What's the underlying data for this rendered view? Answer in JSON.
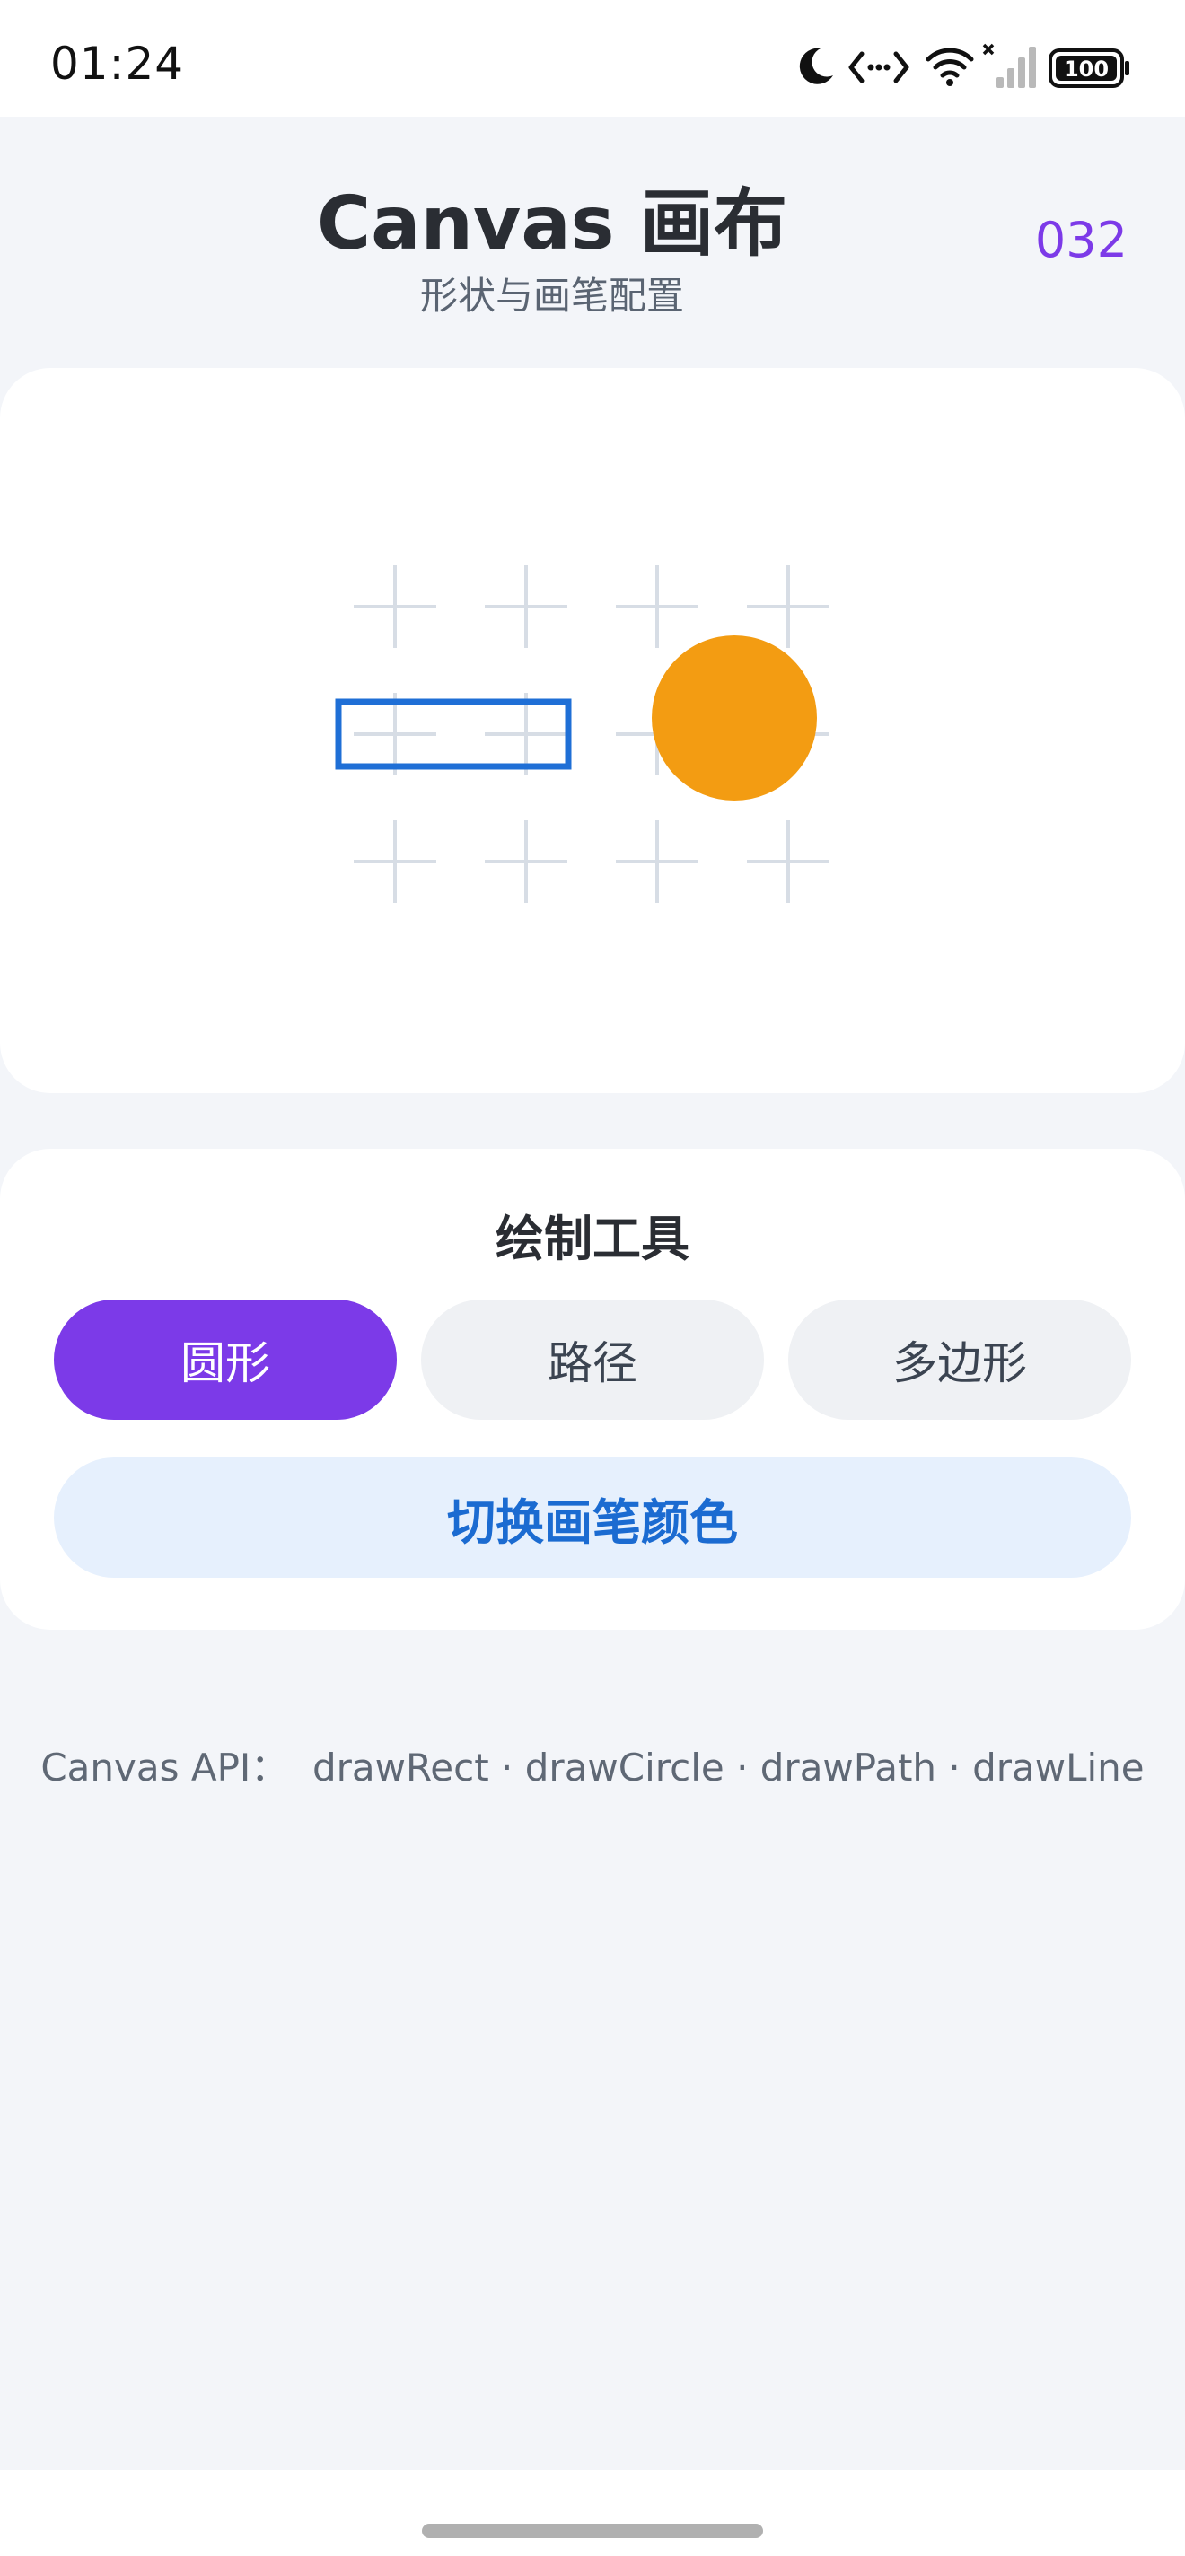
{
  "status_bar": {
    "time": "01:24",
    "icons": [
      "moon-icon",
      "network-arrows-icon",
      "wifi-icon",
      "signal-icon",
      "battery-icon"
    ],
    "battery_level": "100"
  },
  "header": {
    "title": "Canvas 画布",
    "subtitle": "形状与画笔配置",
    "counter": "032"
  },
  "canvas": {
    "shapes": [
      {
        "type": "rectangle",
        "style": "outline",
        "color": "#1f6fd6"
      },
      {
        "type": "circle",
        "style": "filled",
        "color": "#f39c12"
      }
    ],
    "grid_marker_color": "#d7dde5"
  },
  "tools": {
    "title": "绘制工具",
    "buttons": [
      {
        "label": "圆形",
        "selected": true
      },
      {
        "label": "路径",
        "selected": false
      },
      {
        "label": "多边形",
        "selected": false
      }
    ],
    "color_button": "切换画笔颜色"
  },
  "footer": {
    "api_text": "Canvas API：  drawRect · drawCircle · drawPath · drawLine"
  },
  "colors": {
    "accent": "#7c3ae8",
    "blue": "#1b6bd1",
    "orange": "#f39c12",
    "background": "#f3f5f9"
  }
}
